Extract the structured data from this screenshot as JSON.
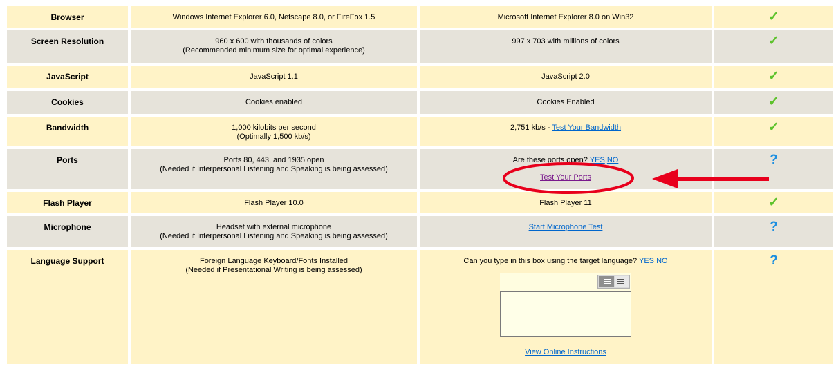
{
  "rows": [
    {
      "label": "Browser",
      "req1": "Windows Internet Explorer 6.0, Netscape 8.0, or FireFox 1.5",
      "req2": "",
      "yours": "Microsoft Internet Explorer 8.0 on Win32",
      "status": "✓"
    },
    {
      "label": "Screen Resolution",
      "req1": "960 x 600 with thousands of colors",
      "req2": "(Recommended minimum size for optimal experience)",
      "yours": "997 x 703 with millions of colors",
      "status": "✓"
    },
    {
      "label": "JavaScript",
      "req1": "JavaScript 1.1",
      "req2": "",
      "yours": "JavaScript 2.0",
      "status": "✓"
    },
    {
      "label": "Cookies",
      "req1": "Cookies enabled",
      "req2": "",
      "yours": "Cookies Enabled",
      "status": "✓"
    },
    {
      "label": "Bandwidth",
      "req1": "1,000 kilobits per second",
      "req2": "(Optimally 1,500 kb/s)",
      "yours": "2,751 kb/s - ",
      "yours_link": "Test Your Bandwidth",
      "status": "✓"
    },
    {
      "label": "Ports",
      "req1": "Ports 80, 443, and 1935 open",
      "req2": "(Needed if Interpersonal Listening and Speaking is being assessed)",
      "yours": "Are these ports open?",
      "yes": "YES",
      "no": "NO",
      "test_link": "Test Your Ports",
      "status": "?"
    },
    {
      "label": "Flash Player",
      "req1": "Flash Player 10.0",
      "req2": "",
      "yours": "Flash Player 11",
      "status": "✓"
    },
    {
      "label": "Microphone",
      "req1": "Headset with external microphone",
      "req2": "(Needed if Interpersonal Listening and Speaking is being assessed)",
      "yours_link": "Start Microphone Test",
      "status": "?"
    },
    {
      "label": "Language Support",
      "req1": "Foreign Language Keyboard/Fonts Installed",
      "req2": "(Needed if Presentational Writing is being assessed)",
      "yours": "Can you type in this box using the target language?",
      "yes": "YES",
      "no": "NO",
      "instr_link": "View Online Instructions",
      "status": "?"
    }
  ],
  "colors": {
    "row_yellow": "#fff3c7",
    "row_gray": "#e6e3da",
    "check": "#5ec22c",
    "question": "#1d8fe0",
    "link": "#0066cc",
    "annotation": "#e8001c"
  }
}
